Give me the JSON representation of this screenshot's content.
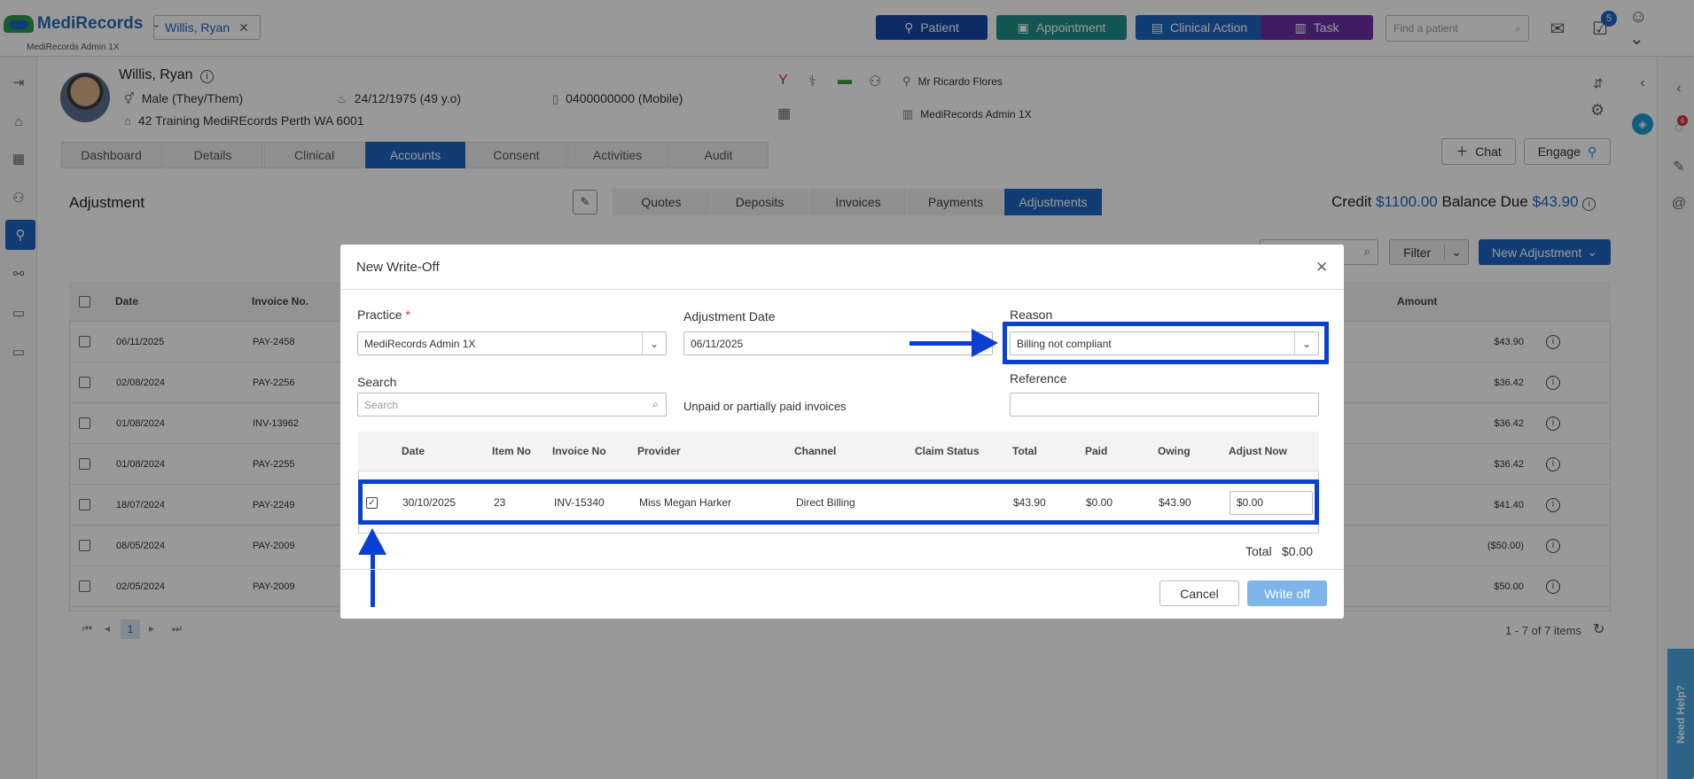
{
  "app": {
    "logo_main": "MediRecords",
    "logo_sub": "MediRecords Admin 1X",
    "patient_chip": "Willis, Ryan",
    "buttons": {
      "patient": "Patient",
      "appointment": "Appointment",
      "clinical_action": "Clinical Action",
      "task": "Task"
    },
    "find_placeholder": "Find a patient",
    "notification_count": "5",
    "chat_badge": "6",
    "need_help": "Need Help?"
  },
  "patient": {
    "name": "Willis, Ryan",
    "gender": "Male (They/Them)",
    "dob": "24/12/1975 (49 y.o)",
    "phone": "0400000000 (Mobile)",
    "address": "42 Training MediREcords Perth WA 6001",
    "practitioner": "Mr Ricardo Flores",
    "practice": "MediRecords Admin 1X"
  },
  "tabs": [
    "Dashboard",
    "Details",
    "Clinical",
    "Accounts",
    "Consent",
    "Activities",
    "Audit"
  ],
  "header_buttons": {
    "chat": "Chat",
    "engage": "Engage"
  },
  "page": {
    "title": "Adjustment",
    "subtabs": [
      "Quotes",
      "Deposits",
      "Invoices",
      "Payments",
      "Adjustments"
    ],
    "credit_label": "Credit",
    "credit_value": "$1100.00",
    "balance_label": "Balance Due",
    "balance_value": "$43.90",
    "filter_label": "Filter",
    "new_adjustment_label": "New Adjustment",
    "columns": {
      "date": "Date",
      "invoice": "Invoice No.",
      "amount": "Amount"
    },
    "rows": [
      {
        "date": "06/11/2025",
        "invoice": "PAY-2458",
        "amount": "$43.90"
      },
      {
        "date": "02/08/2024",
        "invoice": "PAY-2256",
        "amount": "$36.42"
      },
      {
        "date": "01/08/2024",
        "invoice": "INV-13962",
        "amount": "$36.42"
      },
      {
        "date": "01/08/2024",
        "invoice": "PAY-2255",
        "amount": "$36.42"
      },
      {
        "date": "18/07/2024",
        "invoice": "PAY-2249",
        "amount": "$41.40"
      },
      {
        "date": "08/05/2024",
        "invoice": "PAY-2009",
        "amount": "($50.00)"
      },
      {
        "date": "02/05/2024",
        "invoice": "PAY-2009",
        "amount": "$50.00"
      }
    ],
    "pager_page": "1",
    "items_text": "1 - 7 of 7 items"
  },
  "modal": {
    "title": "New Write-Off",
    "practice_label": "Practice",
    "practice_value": "MediRecords Admin 1X",
    "adj_date_label": "Adjustment Date",
    "adj_date_value": "06/11/2025",
    "reason_label": "Reason",
    "reason_value": "Billing not compliant",
    "search_label": "Search",
    "search_placeholder": "Search",
    "unpaid_text": "Unpaid or partially paid invoices",
    "reference_label": "Reference",
    "columns": {
      "date": "Date",
      "item": "Item No",
      "invoice": "Invoice No",
      "provider": "Provider",
      "channel": "Channel",
      "claim": "Claim Status",
      "total": "Total",
      "paid": "Paid",
      "owing": "Owing",
      "adjust": "Adjust Now"
    },
    "row": {
      "date": "30/10/2025",
      "item": "23",
      "invoice": "INV-15340",
      "provider": "Miss Megan Harker",
      "channel": "Direct Billing",
      "claim": "",
      "total": "$43.90",
      "paid": "$0.00",
      "owing": "$43.90",
      "adjust": "$0.00"
    },
    "total_label": "Total",
    "total_value": "$0.00",
    "cancel_label": "Cancel",
    "writeoff_label": "Write off"
  },
  "colors": {
    "brand_blue": "#1f66c1",
    "appointment": "#1f8f8a",
    "task": "#6d2fa8",
    "highlight": "#0a3fd6"
  }
}
